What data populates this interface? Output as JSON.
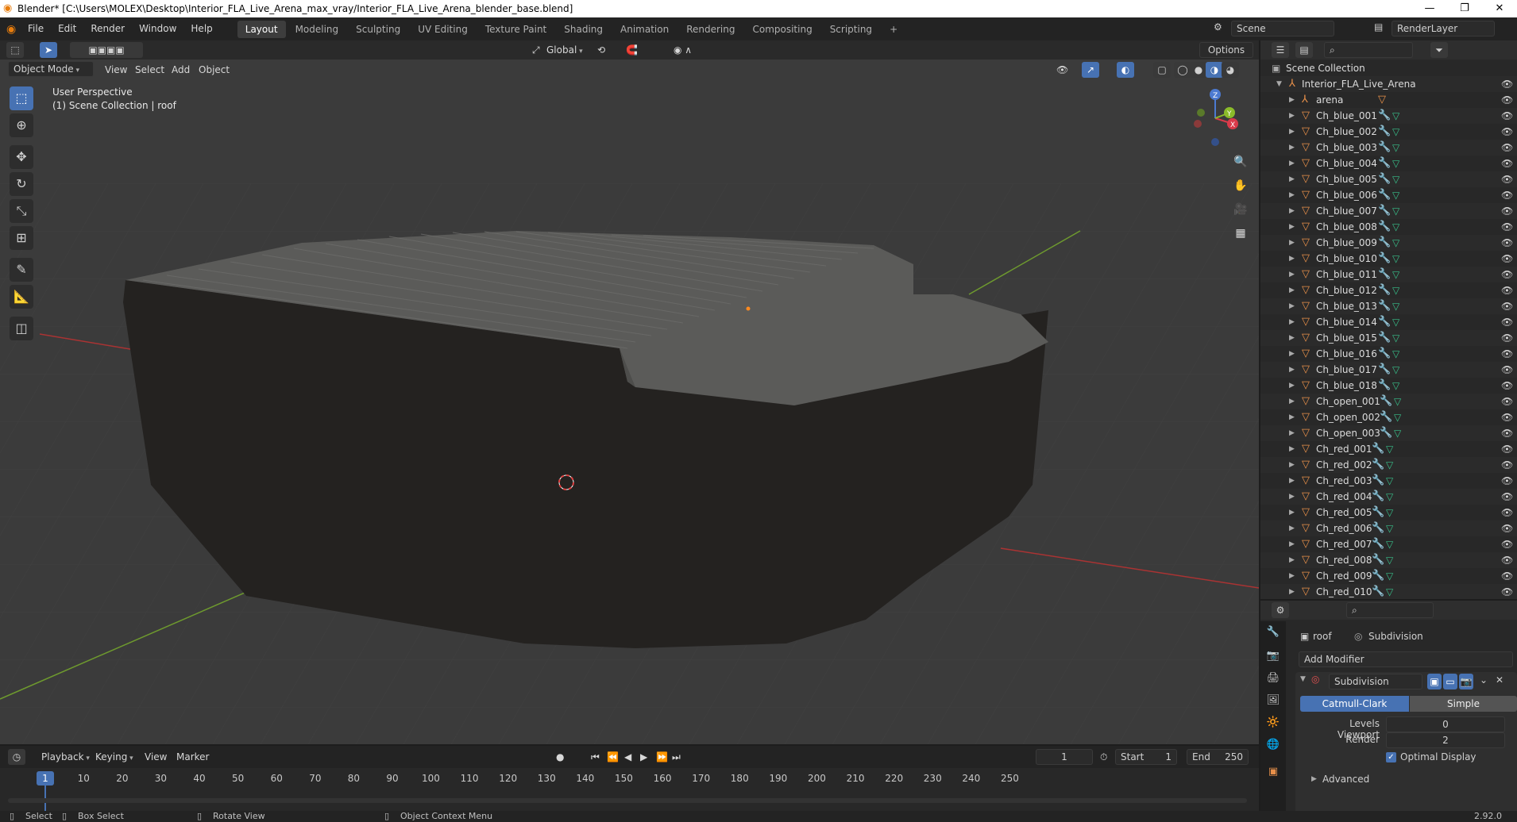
{
  "titlebar": {
    "title": "Blender* [C:\\Users\\MOLEX\\Desktop\\Interior_FLA_Live_Arena_max_vray/Interior_FLA_Live_Arena_blender_base.blend]"
  },
  "menu": {
    "file": "File",
    "edit": "Edit",
    "render": "Render",
    "window": "Window",
    "help": "Help"
  },
  "workspaces": [
    "Layout",
    "Modeling",
    "Sculpting",
    "UV Editing",
    "Texture Paint",
    "Shading",
    "Animation",
    "Rendering",
    "Compositing",
    "Scripting"
  ],
  "scene": {
    "name": "Scene",
    "render_layer": "RenderLayer"
  },
  "toolbar": {
    "orientation": "Global",
    "options": "Options"
  },
  "viewport_header": {
    "mode": "Object Mode",
    "view": "View",
    "select": "Select",
    "add": "Add",
    "object": "Object"
  },
  "viewport": {
    "perspective": "User Perspective",
    "collection_info": "(1) Scene Collection | roof"
  },
  "gizmo": {
    "x": "X",
    "y": "Y",
    "z": "Z"
  },
  "outliner": {
    "root": "Scene Collection",
    "collection": "Interior_FLA_Live_Arena",
    "items": [
      "arena",
      "Ch_blue_001",
      "Ch_blue_002",
      "Ch_blue_003",
      "Ch_blue_004",
      "Ch_blue_005",
      "Ch_blue_006",
      "Ch_blue_007",
      "Ch_blue_008",
      "Ch_blue_009",
      "Ch_blue_010",
      "Ch_blue_011",
      "Ch_blue_012",
      "Ch_blue_013",
      "Ch_blue_014",
      "Ch_blue_015",
      "Ch_blue_016",
      "Ch_blue_017",
      "Ch_blue_018",
      "Ch_open_001",
      "Ch_open_002",
      "Ch_open_003",
      "Ch_red_001",
      "Ch_red_002",
      "Ch_red_003",
      "Ch_red_004",
      "Ch_red_005",
      "Ch_red_006",
      "Ch_red_007",
      "Ch_red_008",
      "Ch_red_009",
      "Ch_red_010"
    ]
  },
  "properties": {
    "object": "roof",
    "modifier_tab": "Subdivision",
    "add_modifier": "Add Modifier",
    "modifier_name": "Subdivision",
    "catmull": "Catmull-Clark",
    "simple": "Simple",
    "levels_label": "Levels Viewport",
    "levels_value": "0",
    "render_label": "Render",
    "render_value": "2",
    "optimal": "Optimal Display",
    "advanced": "Advanced"
  },
  "timeline": {
    "playback": "Playback",
    "keying": "Keying",
    "view": "View",
    "marker": "Marker",
    "current": "1",
    "start_label": "Start",
    "start": "1",
    "end_label": "End",
    "end": "250",
    "ticks": [
      "10",
      "20",
      "30",
      "40",
      "50",
      "60",
      "70",
      "80",
      "90",
      "100",
      "110",
      "120",
      "130",
      "140",
      "150",
      "160",
      "170",
      "180",
      "190",
      "200",
      "210",
      "220",
      "230",
      "240",
      "250"
    ],
    "playhead": "1"
  },
  "status": {
    "select": "Select",
    "box_select": "Box Select",
    "rotate": "Rotate View",
    "context": "Object Context Menu",
    "version": "2.92.0"
  },
  "colors": {
    "accent": "#4772b3",
    "viewport_bg": "#3a3a3a",
    "object_orange": "#e8904a",
    "mesh_green": "#38c08a"
  }
}
